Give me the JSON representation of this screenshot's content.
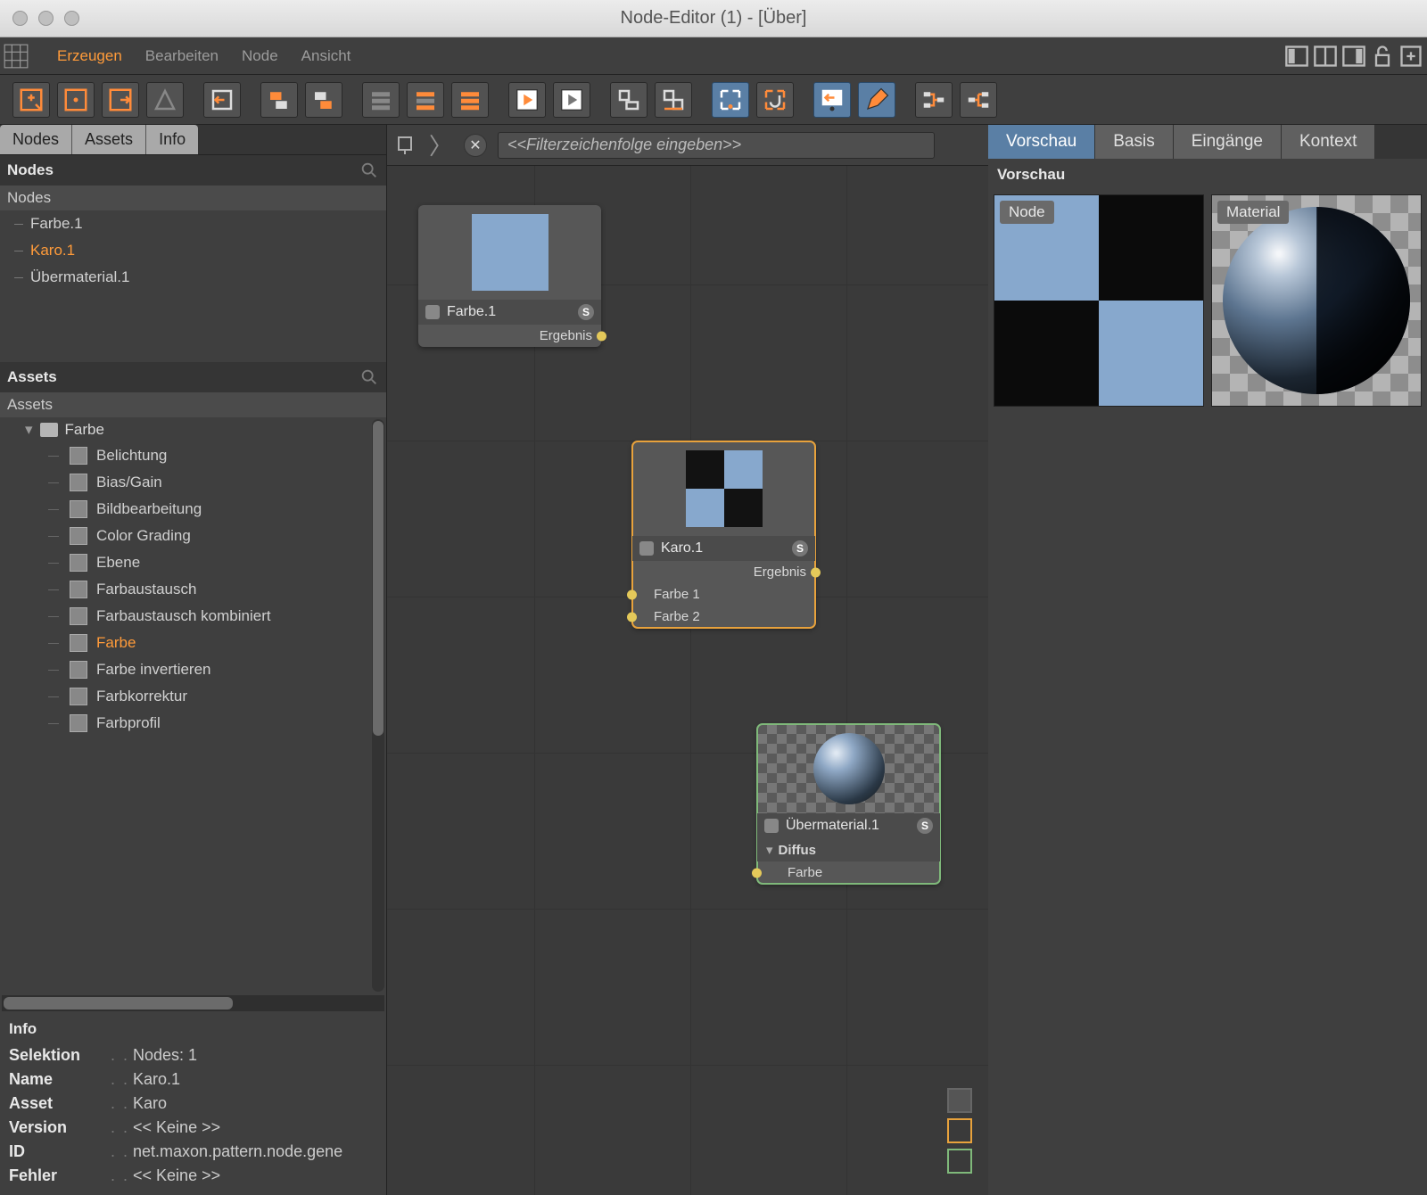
{
  "window": {
    "title": "Node-Editor (1) - [Über]"
  },
  "menu": {
    "items": [
      "Erzeugen",
      "Bearbeiten",
      "Node",
      "Ansicht"
    ],
    "active_index": 0
  },
  "left_tabs": [
    "Nodes",
    "Assets",
    "Info"
  ],
  "nodes_section": {
    "title": "Nodes",
    "header": "Nodes",
    "items": [
      {
        "label": "Farbe.1"
      },
      {
        "label": "Karo.1",
        "selected": true
      },
      {
        "label": "Übermaterial.1"
      }
    ]
  },
  "assets_section": {
    "title": "Assets",
    "header": "Assets",
    "group": "Farbe",
    "items": [
      "Belichtung",
      "Bias/Gain",
      "Bildbearbeitung",
      "Color Grading",
      "Ebene",
      "Farbaustausch",
      "Farbaustausch kombiniert",
      "Farbe",
      "Farbe invertieren",
      "Farbkorrektur",
      "Farbprofil"
    ],
    "selected": "Farbe"
  },
  "info_section": {
    "title": "Info",
    "rows": [
      {
        "k": "Selektion",
        "v": "Nodes: 1"
      },
      {
        "k": "Name",
        "v": "Karo.1"
      },
      {
        "k": "Asset",
        "v": "Karo"
      },
      {
        "k": "Version",
        "v": "<< Keine >>"
      },
      {
        "k": "ID",
        "v": "net.maxon.pattern.node.gene"
      },
      {
        "k": "Fehler",
        "v": "<< Keine >>"
      }
    ]
  },
  "canvas": {
    "filter_placeholder": "<<Filterzeichenfolge eingeben>>",
    "nodes": {
      "farbe": {
        "title": "Farbe.1",
        "out": "Ergebnis"
      },
      "karo": {
        "title": "Karo.1",
        "out": "Ergebnis",
        "in1": "Farbe 1",
        "in2": "Farbe 2"
      },
      "material": {
        "title": "Übermaterial.1",
        "section": "Diffus",
        "in": "Farbe"
      }
    }
  },
  "right_tabs": {
    "items": [
      "Vorschau",
      "Basis",
      "Eingänge",
      "Kontext"
    ],
    "active_index": 0
  },
  "right_section": {
    "title": "Vorschau",
    "tag_node": "Node",
    "tag_material": "Material"
  },
  "colors": {
    "accent": "#ff9b3a",
    "node_blue": "#87a8cd",
    "sel_orange": "#e8a23c",
    "sel_green": "#7fb97a"
  }
}
